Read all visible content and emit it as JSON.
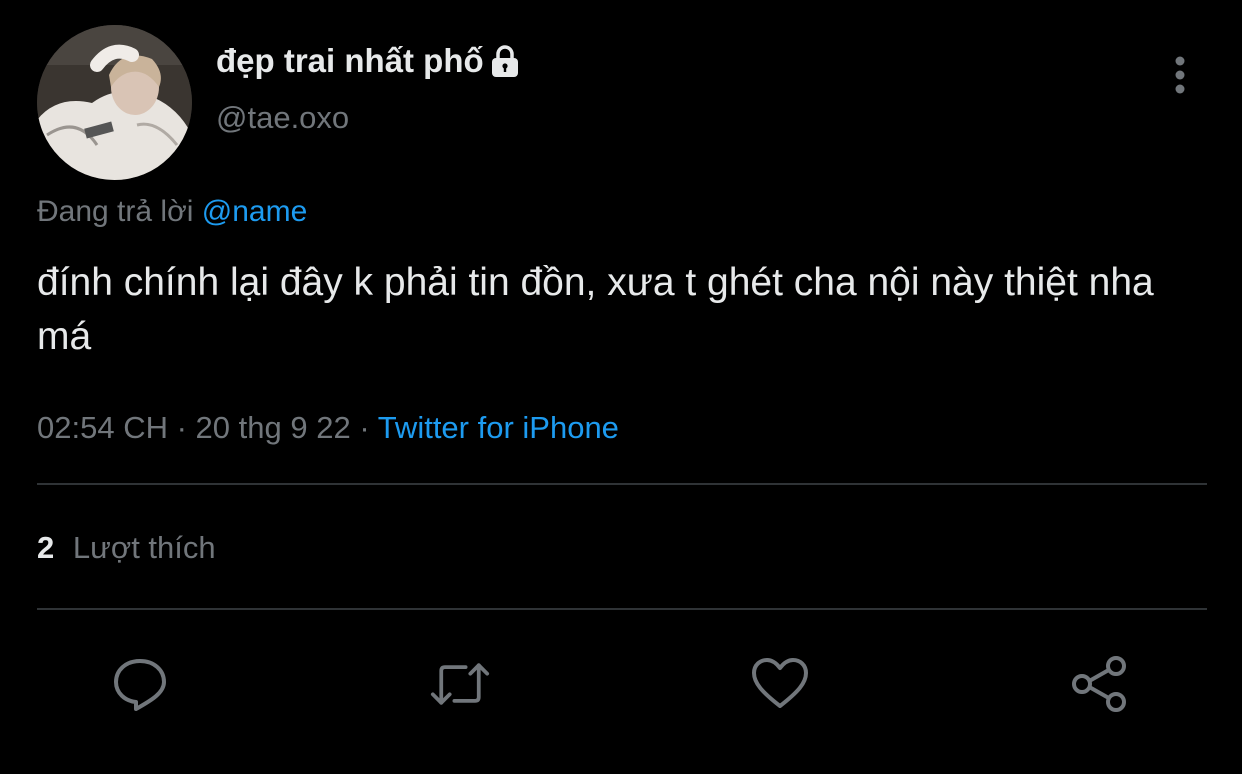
{
  "profile": {
    "display_name": "đẹp trai nhất phố",
    "handle": "@tae.oxo",
    "avatar_icon": "profile-photo",
    "protected_icon": "lock-icon"
  },
  "reply": {
    "prefix": "Đang trả lời",
    "mention": "@name"
  },
  "tweet": {
    "text": "đính chính lại đây k phải tin đồn, xưa t ghét cha nội này thiệt nha má",
    "time": "02:54 CH",
    "separator1": "·",
    "date": "20 thg 9 22",
    "separator2": "·",
    "source": "Twitter for iPhone"
  },
  "stats": {
    "likes_count": "2",
    "likes_label": "Lượt thích"
  },
  "actions": [
    {
      "icon": "reply-icon"
    },
    {
      "icon": "retweet-icon"
    },
    {
      "icon": "like-icon"
    },
    {
      "icon": "share-icon"
    }
  ],
  "colors": {
    "background": "#000000",
    "text_primary": "#e7e9ea",
    "text_secondary": "#71767b",
    "accent": "#1d9bf0",
    "divider": "#2f3336"
  }
}
